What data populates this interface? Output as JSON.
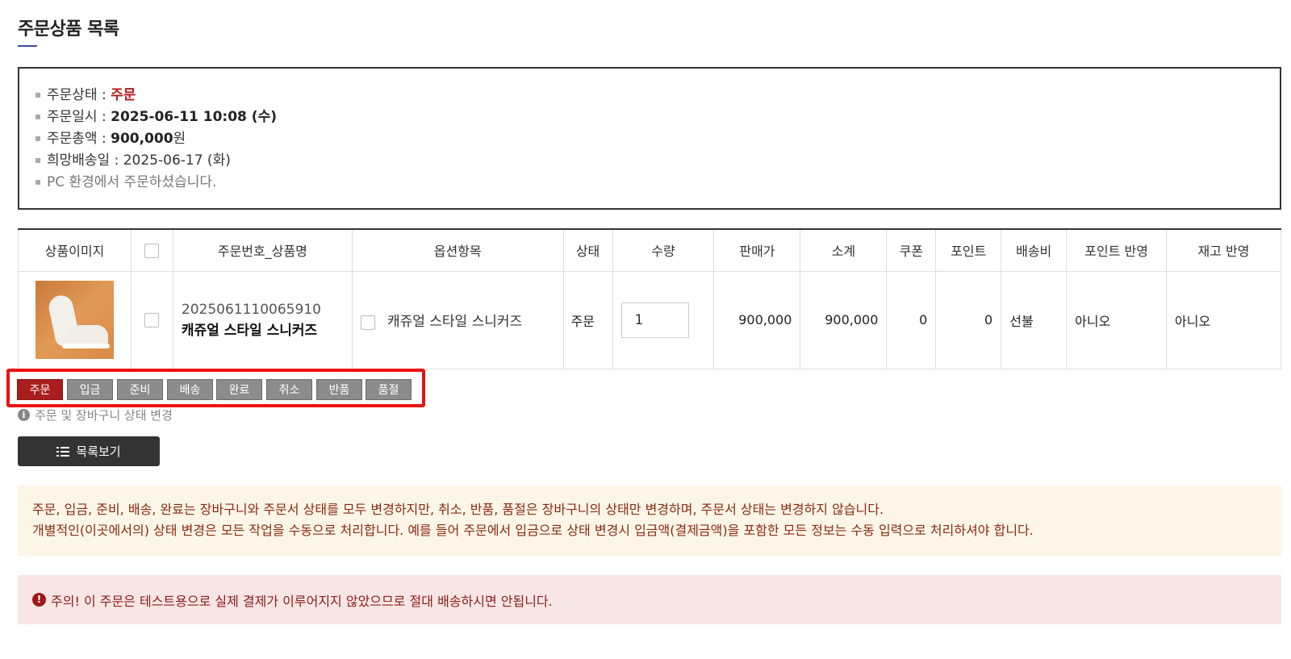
{
  "page": {
    "title": "주문상품 목록"
  },
  "summary": {
    "status_label": "주문상태 : ",
    "status_value": "주문",
    "date_label": "주문일시 : ",
    "date_value": "2025-06-11 10:08 (수)",
    "total_label": "주문총액 : ",
    "total_value": "900,000",
    "total_unit": "원",
    "delivery_label": "희망배송일 : 2025-06-17 (화)",
    "env_note": "PC 환경에서 주문하셨습니다."
  },
  "table": {
    "headers": [
      "상품이미지",
      "",
      "주문번호_상품명",
      "옵션항목",
      "상태",
      "수량",
      "판매가",
      "소계",
      "쿠폰",
      "포인트",
      "배송비",
      "포인트 반영",
      "재고 반영"
    ],
    "row": {
      "order_no": "2025061110065910",
      "product_name": "캐쥬얼 스타일 스니커즈",
      "option": "캐쥬얼 스타일 스니커즈",
      "status": "주문",
      "quantity": "1",
      "price": "900,000",
      "subtotal": "900,000",
      "coupon": "0",
      "point": "0",
      "shipping": "선불",
      "point_applied": "아니오",
      "stock_applied": "아니오"
    }
  },
  "status_buttons": [
    "주문",
    "입금",
    "준비",
    "배송",
    "완료",
    "취소",
    "반품",
    "품절"
  ],
  "active_status": "주문",
  "hint": "주문 및 장바구니 상태 변경",
  "list_button": "목록보기",
  "notice": {
    "line1": "주문, 입금, 준비, 배송, 완료는 장바구니와 주문서 상태를 모두 변경하지만, 취소, 반품, 품절은 장바구니의 상태만 변경하며, 주문서 상태는 변경하지 않습니다.",
    "line2": "개별적인(이곳에서의) 상태 변경은 모든 작업을 수동으로 처리합니다. 예를 들어 주문에서 입금으로 상태 변경시 입금액(결제금액)을 포함한 모든 정보는 수동 입력으로 처리하셔야 합니다."
  },
  "warning": "주의! 이 주문은 테스트용으로 실제 결제가 이루어지지 않았으므로 절대 배송하시면 안됩니다.",
  "colors": {
    "accent_red": "#a91d1d",
    "highlight_border": "#ee1111",
    "title_underline": "#3d4b9e"
  }
}
